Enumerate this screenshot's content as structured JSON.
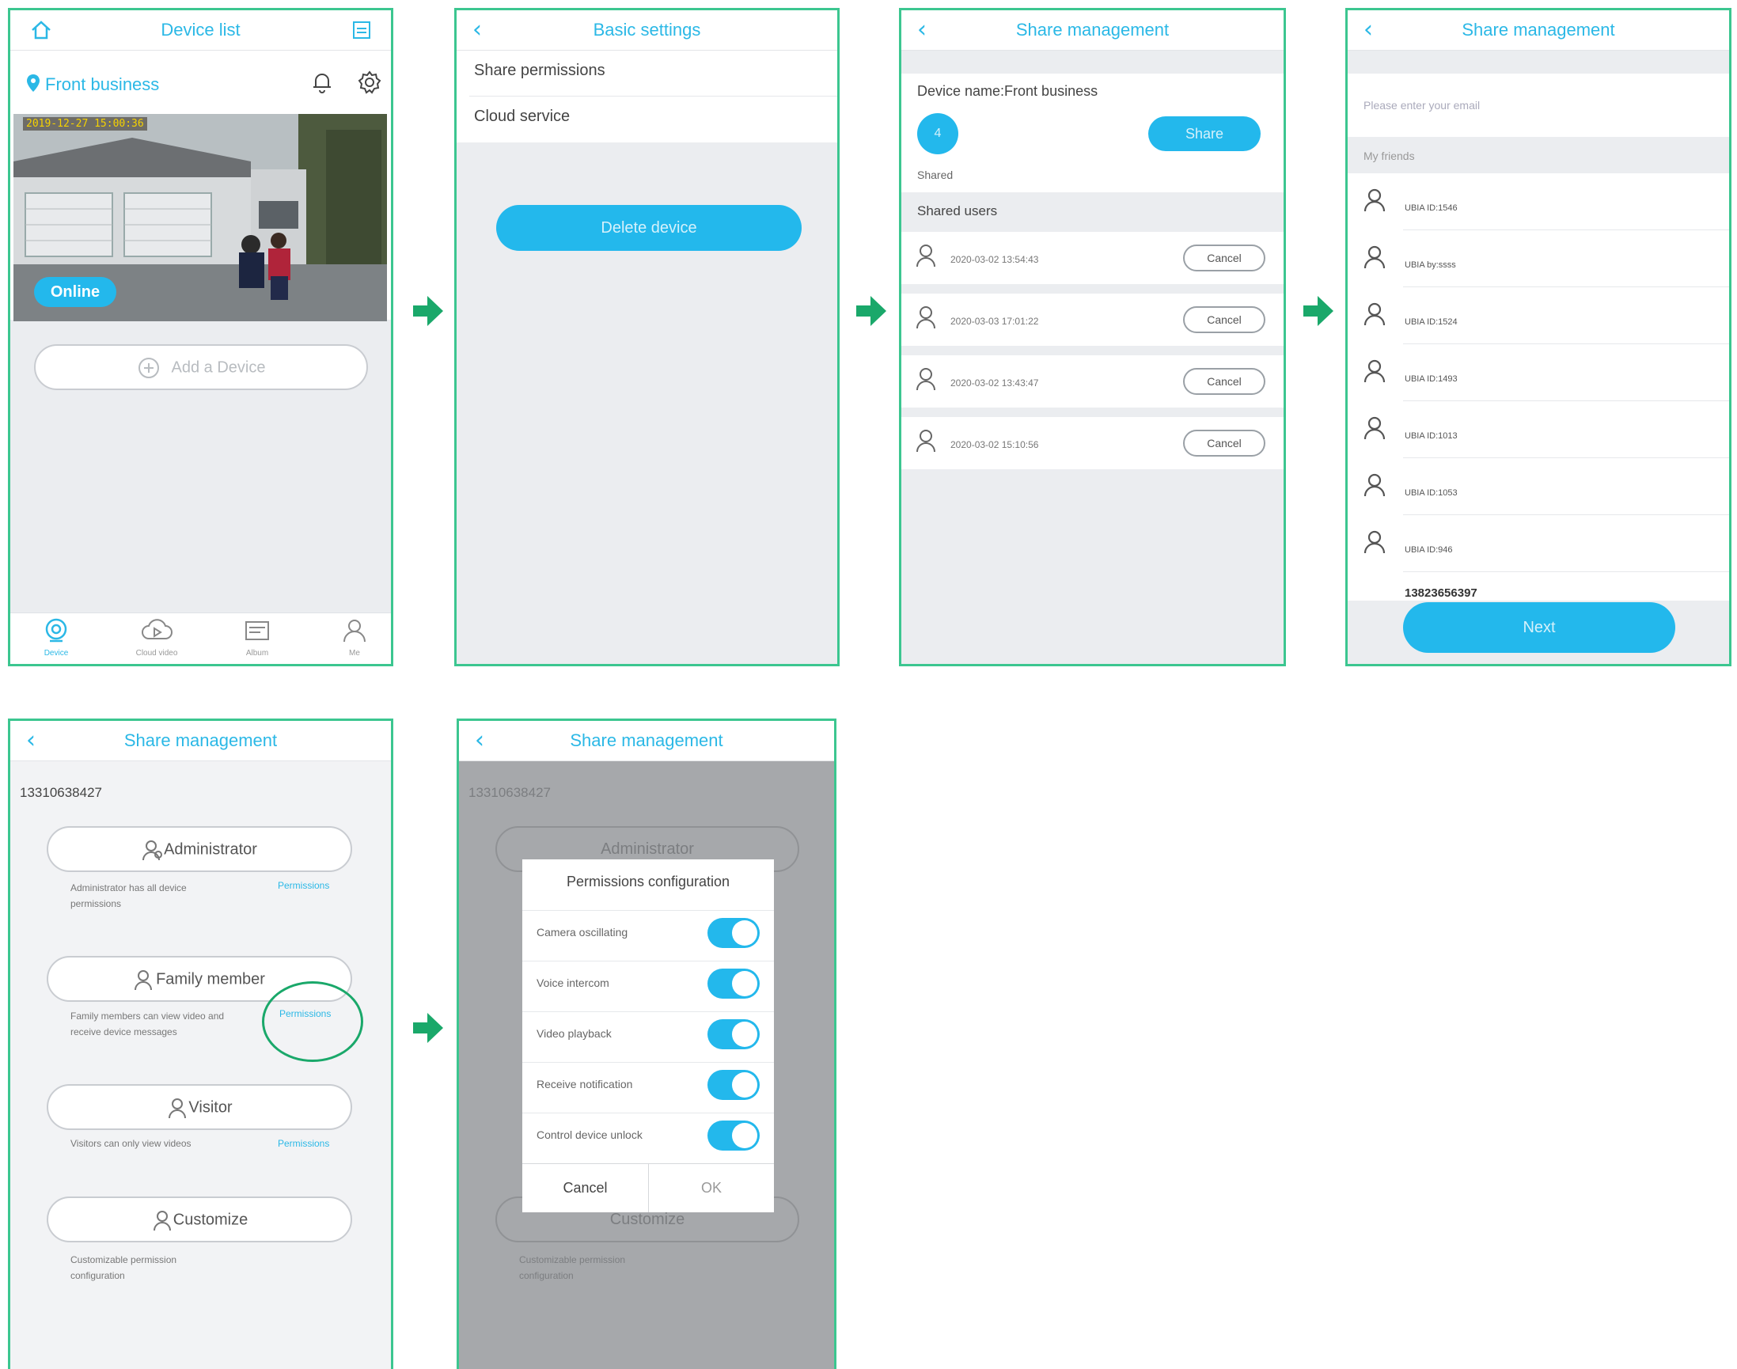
{
  "colors": {
    "accent": "#23b8ec",
    "frame": "#3cc690",
    "arrow": "#1aa86a"
  },
  "screen1": {
    "title": "Device list",
    "device_name": "Front business",
    "timestamp": "2019-12-27  15:00:36",
    "status": "Online",
    "add_device": "Add a Device",
    "tabs": [
      "Device",
      "Cloud video",
      "Album",
      "Me"
    ]
  },
  "screen2": {
    "title": "Basic settings",
    "items": [
      "Share permissions",
      "Cloud service"
    ],
    "delete": "Delete device"
  },
  "screen3": {
    "title": "Share management",
    "device_name": "Device name:Front business",
    "shared_count": "4",
    "shared_label": "Shared",
    "share_btn": "Share",
    "section": "Shared users",
    "users": [
      {
        "date": "2020-03-02 13:54:43",
        "cancel": "Cancel"
      },
      {
        "date": "2020-03-03 17:01:22",
        "cancel": "Cancel"
      },
      {
        "date": "2020-03-02 13:43:47",
        "cancel": "Cancel"
      },
      {
        "date": "2020-03-02 15:10:56",
        "cancel": "Cancel"
      }
    ]
  },
  "screen4": {
    "title": "Share management",
    "email_placeholder": "Please enter your email",
    "section": "My friends",
    "friends": [
      "UBIA ID:1546",
      "UBIA by:ssss",
      "UBIA ID:1524",
      "UBIA ID:1493",
      "UBIA ID:1013",
      "UBIA ID:1053",
      "UBIA ID:946"
    ],
    "partial": "13823656397",
    "next": "Next"
  },
  "screen5": {
    "title": "Share management",
    "account": "13310638427",
    "roles": [
      {
        "name": "Administrator",
        "desc1": "Administrator has all device",
        "desc2": "permissions",
        "link": "Permissions"
      },
      {
        "name": "Family member",
        "desc1": "Family members can view video and",
        "desc2": "receive device messages",
        "link": "Permissions"
      },
      {
        "name": "Visitor",
        "desc1": "Visitors can only view videos",
        "desc2": "",
        "link": "Permissions"
      },
      {
        "name": "Customize",
        "desc1": "Customizable permission",
        "desc2": "configuration",
        "link": ""
      }
    ]
  },
  "screen6": {
    "title": "Share management",
    "account": "13310638427",
    "bg_roles": [
      "Administrator",
      "Customize"
    ],
    "bg_desc1": "Customizable permission",
    "bg_desc2": "configuration",
    "dialog_title": "Permissions configuration",
    "options": [
      "Camera oscillating",
      "Voice intercom",
      "Video playback",
      "Receive notification",
      "Control device unlock"
    ],
    "cancel": "Cancel",
    "ok": "OK"
  }
}
